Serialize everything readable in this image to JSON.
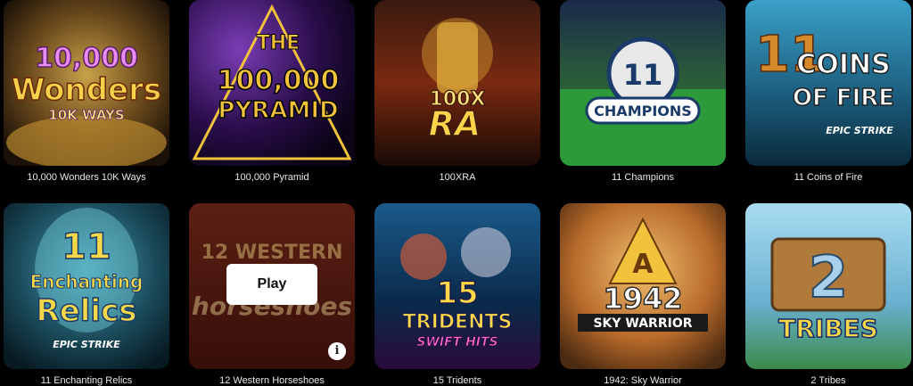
{
  "games": [
    {
      "title": "10,000 Wonders 10K Ways",
      "logo_lines": [
        "10,000",
        "Wonders",
        "10K WAYS"
      ]
    },
    {
      "title": "100,000 Pyramid",
      "logo_lines": [
        "THE",
        "100,000",
        "PYRAMID"
      ]
    },
    {
      "title": "100XRA",
      "logo_lines": [
        "100X",
        "RA"
      ]
    },
    {
      "title": "11 Champions",
      "logo_lines": [
        "11",
        "CHAMPIONS"
      ]
    },
    {
      "title": "11 Coins of Fire",
      "logo_lines": [
        "11",
        "COINS",
        "OF FIRE",
        "EPIC STRIKE"
      ]
    },
    {
      "title": "11 Enchanting Relics",
      "logo_lines": [
        "11",
        "Enchanting",
        "Relics",
        "EPIC STRIKE"
      ]
    },
    {
      "title": "12 Western Horseshoes",
      "logo_lines": [
        "12 WESTERN",
        "horseshoes"
      ]
    },
    {
      "title": "15 Tridents",
      "logo_lines": [
        "15",
        "TRIDENTS",
        "SWIFT HITS"
      ]
    },
    {
      "title": "1942: Sky Warrior",
      "logo_lines": [
        "A",
        "1942",
        "SKY WARRIOR"
      ]
    },
    {
      "title": "2 Tribes",
      "logo_lines": [
        "2",
        "TRIBES"
      ]
    }
  ],
  "hover": {
    "play_label": "Play",
    "info_label": "i"
  },
  "colors": {
    "background": "#000000",
    "title_text": "#e8e8e8",
    "play_button": "#ffffff"
  }
}
